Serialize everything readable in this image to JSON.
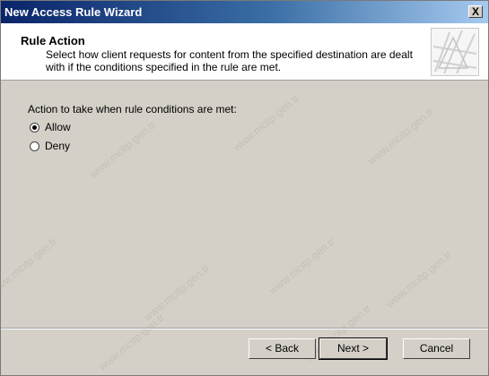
{
  "window": {
    "title": "New Access Rule Wizard",
    "close_label": "X"
  },
  "header": {
    "title": "Rule Action",
    "description": "Select how client requests for content from the specified destination are dealt with if the conditions specified in the rule are met."
  },
  "body": {
    "prompt": "Action to take when rule conditions are met:",
    "options": [
      {
        "label": "Allow",
        "selected": true
      },
      {
        "label": "Deny",
        "selected": false
      }
    ]
  },
  "buttons": {
    "back": "< Back",
    "next": "Next >",
    "cancel": "Cancel"
  },
  "watermark": "www.mcitp.gen.tr"
}
